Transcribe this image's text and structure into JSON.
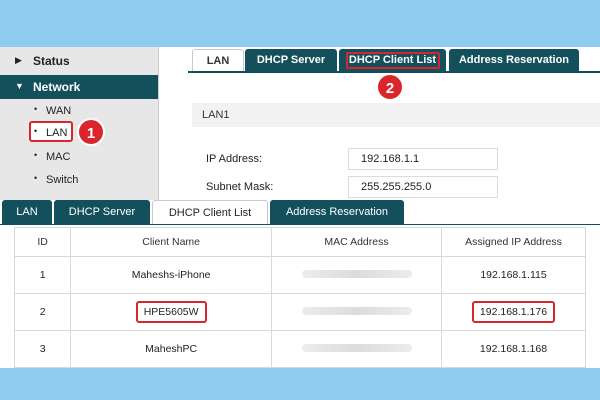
{
  "sidebar": {
    "status": "Status",
    "network": "Network",
    "items": [
      "WAN",
      "LAN",
      "MAC",
      "Switch"
    ],
    "caret_collapsed": "▶",
    "caret_expanded": "▼",
    "bullet": "•"
  },
  "annotations": {
    "badge1": "1",
    "badge2": "2"
  },
  "top_tabs": [
    "LAN",
    "DHCP Server",
    "DHCP Client List",
    "Address Reservation"
  ],
  "lan_section": {
    "title": "LAN1",
    "ip_label": "IP Address:",
    "ip_value": "192.168.1.1",
    "mask_label": "Subnet Mask:",
    "mask_value": "255.255.255.0"
  },
  "bottom_tabs": [
    "LAN",
    "DHCP Server",
    "DHCP Client List",
    "Address Reservation"
  ],
  "client_table": {
    "headers": [
      "ID",
      "Client Name",
      "MAC Address",
      "Assigned IP Address"
    ],
    "rows": [
      {
        "id": "1",
        "name": "Maheshs-iPhone",
        "ip": "192.168.1.115"
      },
      {
        "id": "2",
        "name": "HPE5605W",
        "ip": "192.168.1.176"
      },
      {
        "id": "3",
        "name": "MaheshPC",
        "ip": "192.168.1.168"
      }
    ]
  },
  "colors": {
    "accent": "#14505c",
    "highlight": "#d9252b",
    "background": "#8ecdf0"
  }
}
